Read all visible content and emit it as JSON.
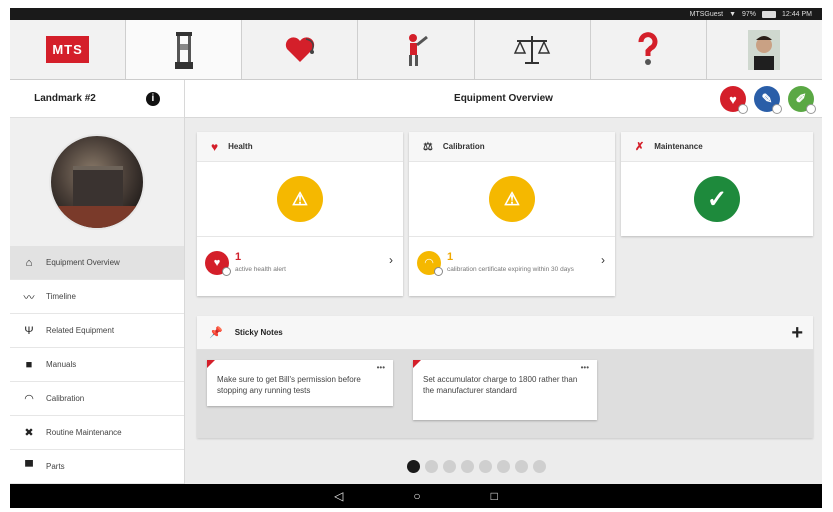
{
  "status": {
    "network": "MTSGuest",
    "battery": "97%",
    "time": "12:44 PM"
  },
  "topnav": {
    "logo": "MTS",
    "tabs": [
      {
        "name": "equipment-tab",
        "icon": "load-frame-icon"
      },
      {
        "name": "health-tab",
        "icon": "heart-stethoscope-icon"
      },
      {
        "name": "maintenance-tab",
        "icon": "wrench-figure-icon"
      },
      {
        "name": "calibration-tab",
        "icon": "balance-scale-icon"
      },
      {
        "name": "help-tab",
        "icon": "question-mark-icon"
      },
      {
        "name": "profile-tab",
        "icon": "user-photo-icon"
      }
    ]
  },
  "sidebar": {
    "title": "Landmark #2",
    "items": [
      {
        "label": "Equipment Overview",
        "icon": "home-icon"
      },
      {
        "label": "Timeline",
        "icon": "trend-line-icon"
      },
      {
        "label": "Related Equipment",
        "icon": "fork-icon"
      },
      {
        "label": "Manuals",
        "icon": "book-icon"
      },
      {
        "label": "Calibration",
        "icon": "gauge-icon"
      },
      {
        "label": "Routine Maintenance",
        "icon": "tools-icon"
      },
      {
        "label": "Parts",
        "icon": "cart-icon"
      }
    ]
  },
  "main": {
    "title": "Equipment Overview",
    "actions": [
      {
        "name": "add-health-alert-button",
        "color": "#d41f2a"
      },
      {
        "name": "add-maintenance-button",
        "color": "#2a5ea8"
      },
      {
        "name": "add-note-button",
        "color": "#5aa844"
      }
    ],
    "cards": {
      "health": {
        "title": "Health",
        "status": "warning",
        "count": "1",
        "desc": "active health alert"
      },
      "calibration": {
        "title": "Calibration",
        "status": "warning",
        "count": "1",
        "desc": "calibration certificate expiring within 30 days"
      },
      "maintenance": {
        "title": "Maintenance",
        "status": "ok"
      }
    },
    "sticky": {
      "title": "Sticky Notes",
      "notes": [
        "Make sure to get Bill's permission before stopping any running tests",
        "Set accumulator charge to 1800 rather than the manufacturer standard"
      ]
    },
    "pager": {
      "pages": 8,
      "current": 1
    }
  },
  "colors": {
    "accent_red": "#d41f2a",
    "warning": "#f5b800",
    "ok": "#1e8a3c"
  }
}
